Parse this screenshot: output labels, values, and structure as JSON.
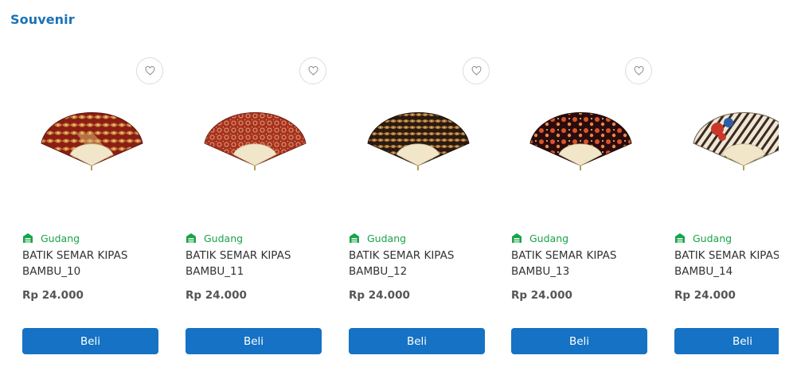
{
  "section": {
    "title": "Souvenir"
  },
  "theme": {
    "accent": "#1572c4",
    "title_color": "#1a73b8",
    "warehouse_color": "#19a347"
  },
  "icons": {
    "wishlist": "heart-outline-icon",
    "warehouse": "warehouse-icon"
  },
  "products": [
    {
      "warehouse": "Gudang",
      "name_line1": "BATIK SEMAR KIPAS",
      "name_line2": "BAMBU_10",
      "price": "Rp 24.000",
      "buy_label": "Beli"
    },
    {
      "warehouse": "Gudang",
      "name_line1": "BATIK SEMAR KIPAS",
      "name_line2": "BAMBU_11",
      "price": "Rp 24.000",
      "buy_label": "Beli"
    },
    {
      "warehouse": "Gudang",
      "name_line1": "BATIK SEMAR KIPAS",
      "name_line2": "BAMBU_12",
      "price": "Rp 24.000",
      "buy_label": "Beli"
    },
    {
      "warehouse": "Gudang",
      "name_line1": "BATIK SEMAR KIPAS",
      "name_line2": "BAMBU_13",
      "price": "Rp 24.000",
      "buy_label": "Beli"
    },
    {
      "warehouse": "Gudang",
      "name_line1": "BATIK SEMAR KIPAS",
      "name_line2": "BAMBU_14",
      "price": "Rp 24.000",
      "buy_label": "Beli"
    }
  ]
}
